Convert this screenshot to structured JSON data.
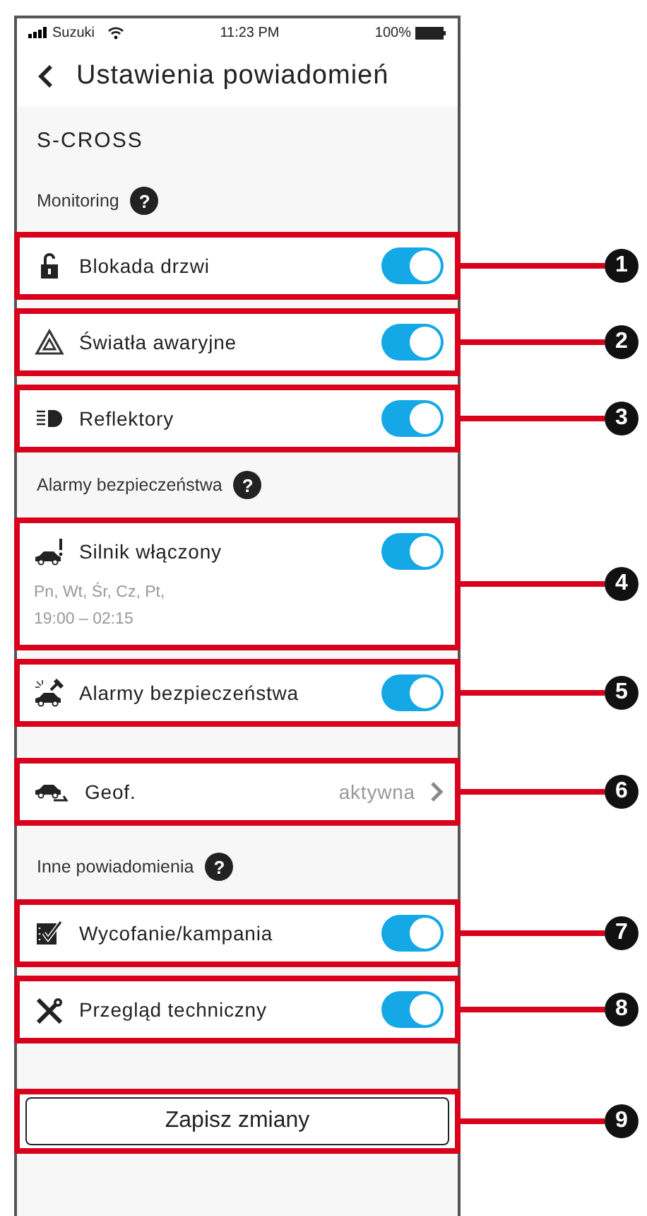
{
  "status_bar": {
    "carrier": "Suzuki",
    "time": "11:23 PM",
    "battery": "100%"
  },
  "header": {
    "title": "Ustawienia powiadomień"
  },
  "vehicle": "S-CROSS",
  "sections": [
    {
      "title": "Monitoring",
      "help": "?",
      "items": [
        {
          "kind": "toggle",
          "label": "Blokada drzwi",
          "on": true,
          "callout": "1"
        },
        {
          "kind": "toggle",
          "label": "Światła awaryjne",
          "on": true,
          "callout": "2"
        },
        {
          "kind": "toggle",
          "label": "Reflektory",
          "on": true,
          "callout": "3"
        }
      ]
    },
    {
      "title": "Alarmy bezpieczeństwa",
      "help": "?",
      "items": [
        {
          "kind": "toggle",
          "label": "Silnik włączony",
          "on": true,
          "detail": "Pn, Wt, Śr, Cz, Pt,\n19:00 – 02:15",
          "callout": "4"
        },
        {
          "kind": "toggle",
          "label": "Alarmy bezpieczeństwa",
          "on": true,
          "callout": "5"
        }
      ]
    },
    {
      "items": [
        {
          "kind": "link",
          "label": "Geof.",
          "value": "aktywna",
          "callout": "6"
        }
      ]
    },
    {
      "title": "Inne powiadomienia",
      "help": "?",
      "items": [
        {
          "kind": "toggle",
          "label": "Wycofanie/kampania",
          "on": true,
          "callout": "7"
        },
        {
          "kind": "toggle",
          "label": "Przegląd techniczny",
          "on": true,
          "callout": "8"
        }
      ]
    }
  ],
  "save_button": {
    "label": "Zapisz zmiany",
    "callout": "9"
  }
}
